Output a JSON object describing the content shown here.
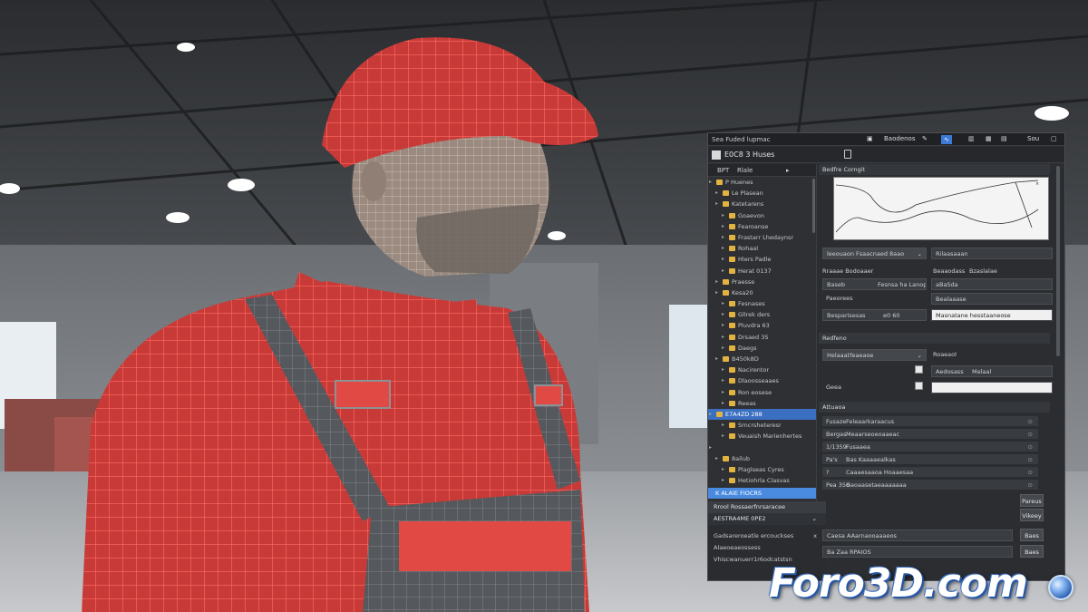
{
  "panel": {
    "menubar_title": "Sea Fuded lupmac",
    "menubar_right": [
      "Baodenos",
      "Sou"
    ],
    "header_title": "E0C8 3 Huses",
    "tree_header": [
      "BPT",
      "Rlale"
    ],
    "tree_items": [
      {
        "label": "P Huenes",
        "indent": 0,
        "sel": false
      },
      {
        "label": "Le Plasean",
        "indent": 1,
        "sel": false
      },
      {
        "label": "Katetarens",
        "indent": 1,
        "sel": false
      },
      {
        "label": "Goaevon",
        "indent": 2,
        "sel": false
      },
      {
        "label": "Fearoanse",
        "indent": 2,
        "sel": false
      },
      {
        "label": "Frastarr Lhedaynsr",
        "indent": 2,
        "sel": false
      },
      {
        "label": "Rohaal",
        "indent": 2,
        "sel": false
      },
      {
        "label": "Hlers Padle",
        "indent": 2,
        "sel": false
      },
      {
        "label": "Herat 0137",
        "indent": 2,
        "sel": false
      },
      {
        "label": "Praesse",
        "indent": 1,
        "sel": false
      },
      {
        "label": "Kesa20",
        "indent": 1,
        "sel": false
      },
      {
        "label": "Fesnases",
        "indent": 2,
        "sel": false
      },
      {
        "label": "Gllrek ders",
        "indent": 2,
        "sel": false
      },
      {
        "label": "Pluvdra 63",
        "indent": 2,
        "sel": false
      },
      {
        "label": "Drsaed 3S",
        "indent": 2,
        "sel": false
      },
      {
        "label": "Daegs",
        "indent": 2,
        "sel": false
      },
      {
        "label": "B450k8D",
        "indent": 1,
        "sel": false
      },
      {
        "label": "Nacirentor",
        "indent": 2,
        "sel": false
      },
      {
        "label": "Dlaoosseaaes",
        "indent": 2,
        "sel": false
      },
      {
        "label": "Ron eosese",
        "indent": 2,
        "sel": false
      },
      {
        "label": "Reeas",
        "indent": 2,
        "sel": false
      },
      {
        "label": "E7A4ZD 288",
        "indent": 0,
        "sel": true
      },
      {
        "label": "Srncrsheteresr",
        "indent": 2,
        "sel": false
      },
      {
        "label": "Veuaish Marienhertes",
        "indent": 2,
        "sel": false
      },
      {
        "label": "",
        "indent": 0,
        "sel": false
      },
      {
        "label": "8ailub",
        "indent": 1,
        "sel": false
      },
      {
        "label": "Plaglseas Cyres",
        "indent": 2,
        "sel": false
      },
      {
        "label": "Hetiohrla Clasvas",
        "indent": 2,
        "sel": false
      }
    ],
    "tree_selected_bottom": "K ALAIE FIOCRS",
    "bottom_left": {
      "header": "Rrool Rossaerfnrsaracee",
      "subheader": "AESTRA4ME 0PE2",
      "rows": [
        {
          "label": "Gadsareroeatle ercouckses",
          "mark": "x"
        },
        {
          "label": "Alaeoeaeossess",
          "mark": ""
        },
        {
          "label": "Vhiscwanuerr1r6odcatstsn",
          "mark": ""
        }
      ]
    },
    "right": {
      "curve_title": "Bedfre Corngit",
      "dropdown1": "leeouaon Fsaacnaed 8aao",
      "dropdown2": "Rilaasaaan",
      "fields": [
        {
          "label": "Rraaae Bodoaaer",
          "value": "Bzaslalae"
        },
        {
          "label": "Baseb",
          "value": "Fesnsa ha Lanop"
        },
        {
          "label": "Paeorees",
          "value": ""
        },
        {
          "label": "Besparisesas",
          "value": "e0 60"
        }
      ],
      "right_fields": [
        "Beaaodass",
        "aBaSda",
        "Bealaaase"
      ],
      "right_light": "Masnatane hesstaaneose",
      "section2_title": "Redfeno",
      "dropdown3": "Helaaatfeaeaoe",
      "section2_right": [
        "Roaeaol",
        "Aedosass",
        "Melaal"
      ],
      "section2_fields": [
        "Geea"
      ],
      "attr_title": "Attuaoa",
      "attrs": [
        {
          "k": "Fusaze",
          "v": "Feleaarkaraacus"
        },
        {
          "k": "Bergas",
          "v": "Meaarseoeoaaeac"
        },
        {
          "k": "1/1359",
          "v": "Fusaaea"
        },
        {
          "k": "Pa's",
          "v": "Bas Kaaaaealkas"
        },
        {
          "k": "?",
          "v": "Caaaesaaoa Hoaaesaa"
        },
        {
          "k": "Pea 358",
          "v": "Gaoaasetaeaaaaaaa"
        }
      ],
      "side_buttons": [
        "Pareus",
        "Vikeey"
      ],
      "footer_rows": [
        {
          "label": "Caesa AAarnaooaaaeos",
          "btn": "Baes"
        },
        {
          "label": "Ba Zaa RPAIOS",
          "btn": "Baes"
        }
      ]
    }
  },
  "watermark": {
    "text": "Foro3D.com"
  }
}
